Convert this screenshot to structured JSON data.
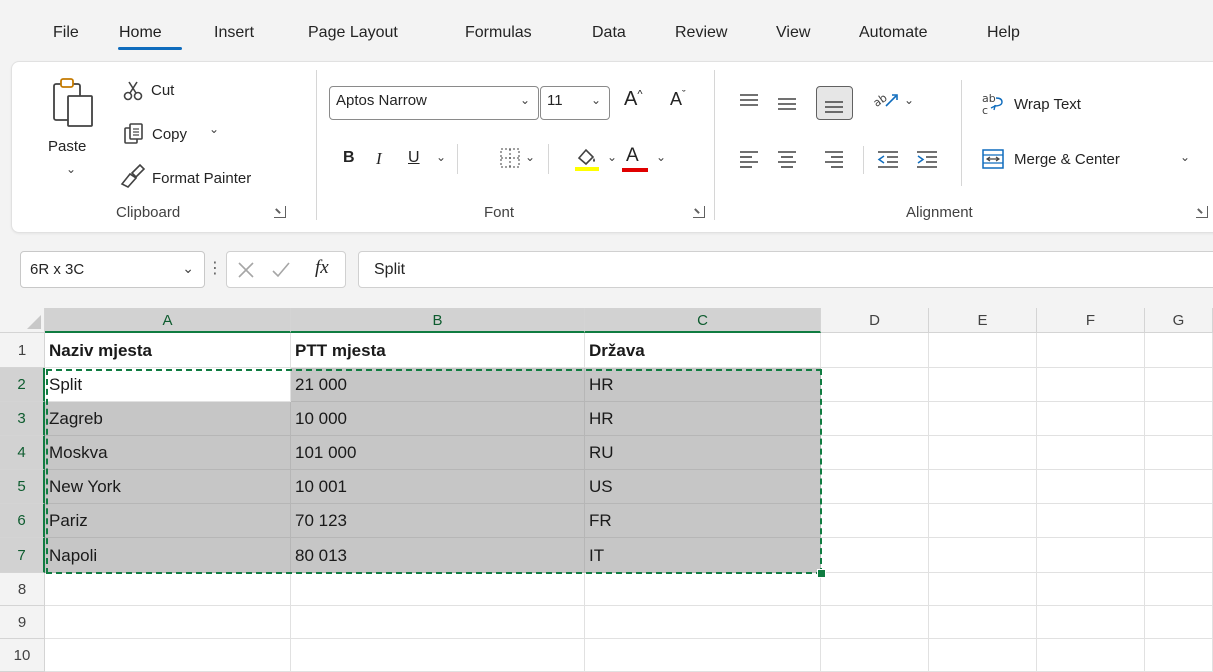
{
  "menu": {
    "tabs": [
      {
        "label": "File"
      },
      {
        "label": "Home"
      },
      {
        "label": "Insert"
      },
      {
        "label": "Page Layout"
      },
      {
        "label": "Formulas"
      },
      {
        "label": "Data"
      },
      {
        "label": "Review"
      },
      {
        "label": "View"
      },
      {
        "label": "Automate"
      },
      {
        "label": "Help"
      }
    ],
    "active_tab": "Home"
  },
  "ribbon": {
    "clipboard": {
      "paste": "Paste",
      "cut": "Cut",
      "copy": "Copy",
      "format_painter": "Format Painter",
      "group_label": "Clipboard"
    },
    "font": {
      "font_name": "Aptos Narrow",
      "font_size": "11",
      "bold": "B",
      "italic": "I",
      "underline": "U",
      "font_color_letter": "A",
      "grow": "A",
      "shrink": "A",
      "group_label": "Font",
      "fill_color": "#ffff00",
      "text_color": "#e00000"
    },
    "alignment": {
      "wrap_text": "Wrap Text",
      "merge_center": "Merge & Center",
      "group_label": "Alignment"
    }
  },
  "formula_bar": {
    "name_box": "6R x 3C",
    "fx": "fx",
    "content": "Split"
  },
  "sheet": {
    "columns": [
      "A",
      "B",
      "C",
      "D",
      "E",
      "F",
      "G"
    ],
    "rows": [
      "1",
      "2",
      "3",
      "4",
      "5",
      "6",
      "7",
      "8",
      "9",
      "10"
    ],
    "headers": [
      "Naziv mjesta",
      "PTT mjesta",
      "Država"
    ],
    "data": [
      [
        "Split",
        "21 000",
        "HR"
      ],
      [
        "Zagreb",
        "10 000",
        "HR"
      ],
      [
        "Moskva",
        "101 000",
        "RU"
      ],
      [
        "New York",
        "10 001",
        "US"
      ],
      [
        "Pariz",
        "70 123",
        "FR"
      ],
      [
        "Napoli",
        "80 013",
        "IT"
      ]
    ],
    "selection_color": "#c6c6c6",
    "marquee_color": "#107c41"
  }
}
